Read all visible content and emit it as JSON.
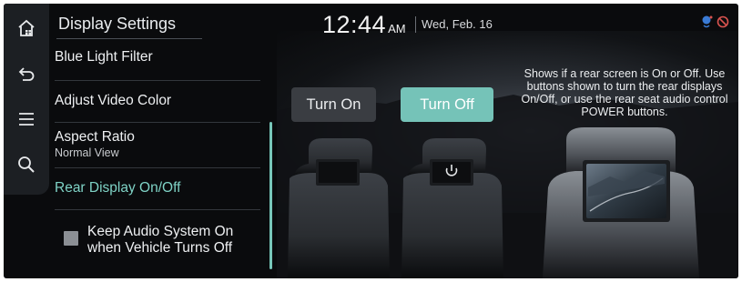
{
  "header": {
    "title": "Display Settings",
    "time": "12:44",
    "ampm": "AM",
    "date": "Wed, Feb. 16"
  },
  "rail": {
    "icons": [
      "home-icon",
      "back-icon",
      "menu-icon",
      "search-icon"
    ]
  },
  "menu": {
    "items": [
      {
        "label": "Blue Light Filter"
      },
      {
        "label": "Adjust Video Color"
      },
      {
        "label": "Aspect Ratio",
        "sub": "Normal View"
      },
      {
        "label": "Rear Display On/Off",
        "active": true
      }
    ],
    "checkbox": {
      "label": "Keep Audio System On when Vehicle Turns Off",
      "checked": false
    }
  },
  "buttons": {
    "turn_on": "Turn On",
    "turn_off": "Turn Off"
  },
  "info": {
    "text": "Shows if a rear screen is On or Off. Use buttons shown to turn the rear displays On/Off, or use the rear seat audio control POWER buttons."
  },
  "status_icons": [
    "voice-recognition-icon",
    "mute-icon"
  ],
  "colors": {
    "accent": "#75c3b8",
    "active_text": "#7fd3c6",
    "background": "#0a0b0d"
  }
}
